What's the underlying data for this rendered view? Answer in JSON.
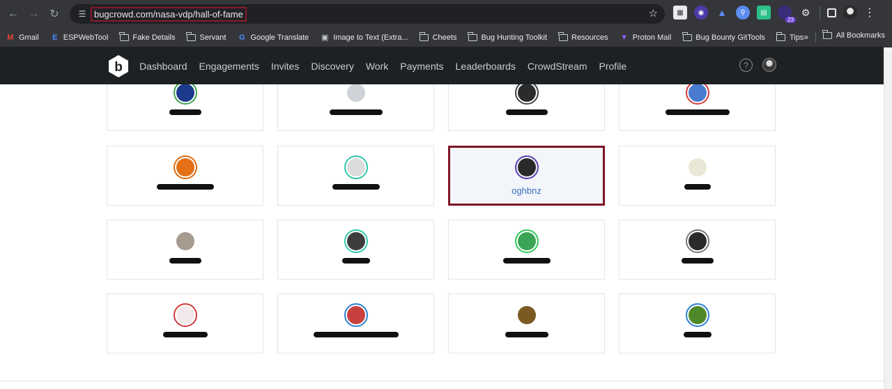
{
  "browser": {
    "url": "bugcrowd.com/nasa-vdp/hall-of-fame",
    "nav_icons": {
      "back": "back-arrow-icon",
      "forward": "forward-arrow-icon",
      "reload": "reload-icon"
    },
    "extension_badge": "23",
    "bookmarks": [
      {
        "label": "Gmail",
        "icon": "gmail-icon"
      },
      {
        "label": "ESPWebTool",
        "icon": "e-icon"
      },
      {
        "label": "Fake Details",
        "icon": "folder-icon"
      },
      {
        "label": "Servant",
        "icon": "folder-icon"
      },
      {
        "label": "Google Translate",
        "icon": "translate-icon"
      },
      {
        "label": "Image to Text (Extra...",
        "icon": "image-icon"
      },
      {
        "label": "Cheets",
        "icon": "folder-icon"
      },
      {
        "label": "Bug Hunting Toolkit",
        "icon": "folder-icon"
      },
      {
        "label": "Resources",
        "icon": "folder-icon"
      },
      {
        "label": "Proton Mail",
        "icon": "proton-icon"
      },
      {
        "label": "Bug Bounty GitTools",
        "icon": "folder-icon"
      },
      {
        "label": "Tips",
        "icon": "folder-icon"
      }
    ],
    "more_bookmarks": "»",
    "all_bookmarks": "All Bookmarks"
  },
  "site": {
    "logo_letter": "b",
    "nav": [
      "Dashboard",
      "Engagements",
      "Invites",
      "Discovery",
      "Work",
      "Payments",
      "Leaderboards",
      "CrowdStream",
      "Profile"
    ],
    "help": "?"
  },
  "hall_of_fame": {
    "highlighted_name": "oghbnz",
    "cards": [
      {
        "ring": "#3fa34d",
        "fill": "#1b3a8c",
        "redacted": true
      },
      {
        "ring": "#ffffff",
        "fill": "#cfd2d6",
        "redacted": true
      },
      {
        "ring": "#444444",
        "fill": "#2b2b2b",
        "redacted": true
      },
      {
        "ring": "#d23b3b",
        "fill": "#4a7bd0",
        "redacted": true
      },
      {
        "ring": "#e06a10",
        "fill": "#e46f15",
        "redacted": true
      },
      {
        "ring": "#2fc7a8",
        "fill": "#dcdcdc",
        "redacted": true
      },
      {
        "ring": "#5b3fb0",
        "fill": "#2a2a2a",
        "redacted": false,
        "name": "oghbnz"
      },
      {
        "ring": "#ffffff",
        "fill": "#e9e7d5",
        "redacted": true
      },
      {
        "ring": "#ffffff",
        "fill": "#a79a8e",
        "redacted": true
      },
      {
        "ring": "#2fc7a8",
        "fill": "#3d3d3d",
        "redacted": true
      },
      {
        "ring": "#2fc75a",
        "fill": "#3aa655",
        "redacted": true
      },
      {
        "ring": "#777777",
        "fill": "#2a2a2a",
        "redacted": true
      },
      {
        "ring": "#d23b3b",
        "fill": "#f2eaea",
        "redacted": true
      },
      {
        "ring": "#2a7fd0",
        "fill": "#c84040",
        "redacted": true
      },
      {
        "ring": "#ffffff",
        "fill": "#7a5a22",
        "redacted": true
      },
      {
        "ring": "#2a7fd0",
        "fill": "#4f8a2a",
        "redacted": true
      }
    ]
  }
}
